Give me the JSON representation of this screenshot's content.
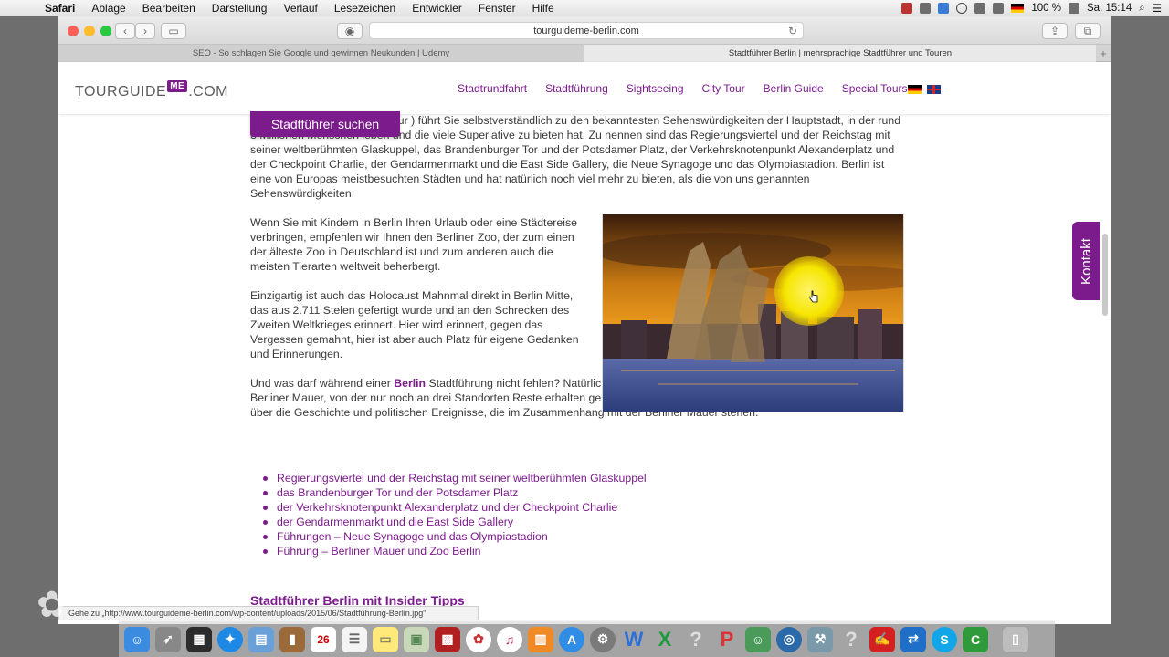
{
  "menubar": {
    "items": [
      "Safari",
      "Ablage",
      "Bearbeiten",
      "Darstellung",
      "Verlauf",
      "Lesezeichen",
      "Entwickler",
      "Fenster",
      "Hilfe"
    ],
    "battery": "100 %",
    "clock": "Sa. 15:14"
  },
  "browser": {
    "address": "tourguideme-berlin.com",
    "tabs": [
      "SEO - So schlagen Sie Google und gewinnen Neukunden | Udemy",
      "Stadtführer Berlin | mehrsprachige Stadtführer und Touren"
    ],
    "status_url": "Gehe zu „http://www.tourguideme-berlin.com/wp-content/uploads/2015/06/Stadtführung-Berlin.jpg“"
  },
  "site": {
    "logo_left": "TOURGUIDE",
    "logo_me": "ME",
    "logo_right": ".COM",
    "nav": [
      "Stadtrundfahrt",
      "Stadtführung",
      "Sightseeing",
      "City Tour",
      "Berlin Guide",
      "Special Tours"
    ],
    "search_button": "Stadtführer suchen",
    "kontakt": "Kontakt",
    "paragraph1": "Unsere Stadtführung ( City Tour ) führt Sie selbstverständlich zu den bekanntesten Sehenswürdigkeiten der Hauptstadt, in der rund 3 Millionen Menschen leben und die viele Superlative zu bieten hat. Zu nennen sind das Regierungsviertel und der Reichstag mit seiner weltberühmten Glaskuppel, das Brandenburger Tor und der Potsdamer Platz, der Verkehrsknotenpunkt Alexanderplatz und der Checkpoint Charlie, der Gendarmenmarkt und die East Side Gallery, die Neue Synagoge und das Olympiastadion. Berlin ist eine von Europas meistbesuchten Städten und hat natürlich noch viel mehr zu bieten, als die von uns genannten Sehenswürdigkeiten.",
    "paragraph2": "Wenn Sie mit Kindern in Berlin Ihren Urlaub oder eine Städtereise verbringen, empfehlen wir Ihnen den Berliner Zoo, der zum einen der älteste Zoo in Deutschland ist und zum anderen auch die meisten Tierarten weltweit beherbergt.",
    "paragraph3": "Einzigartig ist auch das Holocaust Mahnmal direkt in Berlin Mitte, das aus 2.711 Stelen gefertigt wurde und an den Schrecken des Zweiten Weltkrieges erinnert. Hier wird erinnert, gegen das Vergessen gemahnt, hier ist aber auch Platz für eigene Gedanken und Erinnerungen.",
    "paragraph4_before": "Und was darf während einer ",
    "paragraph4_bold": "Berlin",
    "paragraph4_after": " Stadtführung nicht fehlen? Natürlich eine Mauertour. Spazieren Sie entlang der ehemaligen Berliner Mauer, von der nur noch an drei Standorten Reste erhalten geblieben sind. Unterwegs informiert Sie Ihr Stadtführer Berlin über die Geschichte und politischen Ereignisse, die im Zusammenhang mit der Berliner Mauer stehen.",
    "bullets": [
      "Regierungsviertel und der Reichstag mit seiner weltberühmten Glaskuppel",
      "das Brandenburger Tor und der Potsdamer Platz",
      "der Verkehrsknotenpunkt Alexanderplatz und der Checkpoint Charlie",
      "der Gendarmenmarkt und die East Side Gallery",
      "Führungen –  Neue Synagoge und das Olympiastadion",
      "Führung – Berliner Mauer und Zoo Berlin"
    ],
    "subheading": "Stadtführer Berlin mit Insider Tipps"
  },
  "dock": {
    "items": [
      "finder-icon",
      "launchpad-icon",
      "dashboard-icon",
      "safari-icon",
      "preview-icon",
      "notes-icon",
      "calendar-icon",
      "reminders-icon",
      "stickies-icon",
      "photo-icon",
      "photo-booth-icon",
      "itunes-icon",
      "ibooks-icon",
      "app-store-icon",
      "system-preferences-icon",
      "word-icon",
      "excel-icon",
      "help-icon",
      "powerpoint-icon",
      "contacts-icon",
      "network-icon",
      "utility-icon",
      "help-icon",
      "acrobat-icon",
      "teamviewer-icon",
      "skype-icon",
      "camtasia-icon",
      "trash-icon"
    ],
    "calendar_day": "26",
    "word_letter": "W",
    "excel_letter": "X",
    "help_glyph": "?",
    "skype_letter": "S"
  },
  "colors": {
    "brand_purple": "#7b1b8c"
  }
}
